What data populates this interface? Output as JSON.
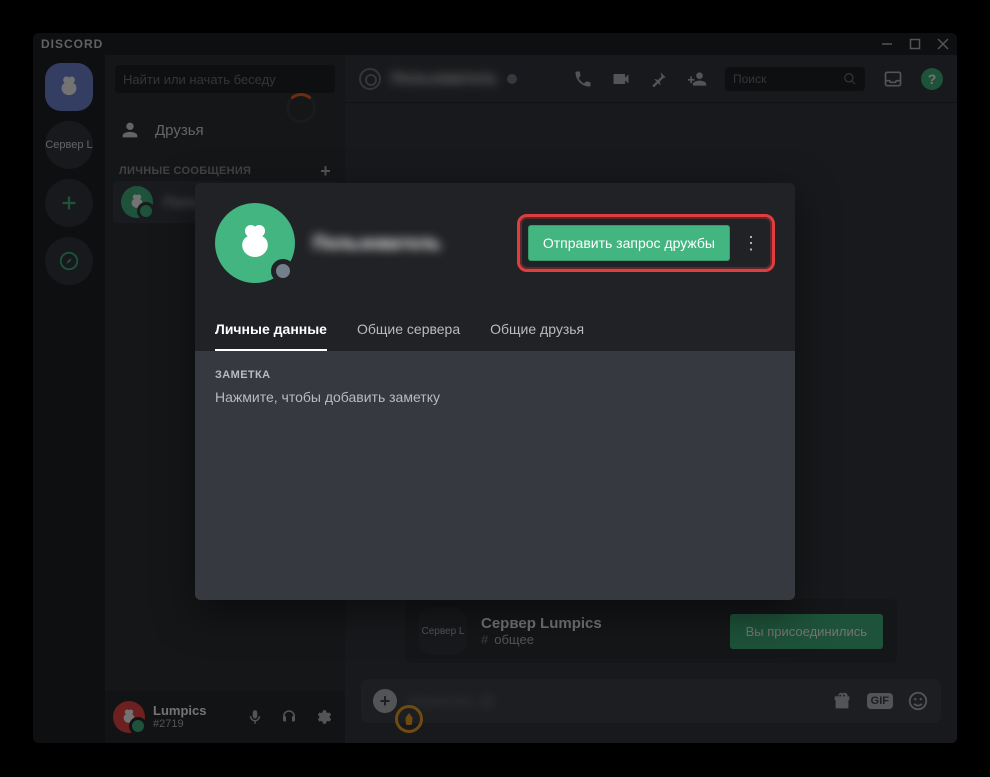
{
  "window": {
    "wordmark": "DISCORD"
  },
  "guilds": {
    "server_label": "Сервер L"
  },
  "sidebar": {
    "search_placeholder": "Найти или начать беседу",
    "friends_label": "Друзья",
    "dm_header": "ЛИЧНЫЕ СООБЩЕНИЯ",
    "dm_items": [
      {
        "name": "Пользователь"
      }
    ]
  },
  "user_panel": {
    "name": "Lumpics",
    "tag": "#2719"
  },
  "chat_header": {
    "name": "Пользователь",
    "search_placeholder": "Поиск"
  },
  "invite": {
    "logo_text": "Сервер L",
    "title": "Сервер Lumpics",
    "channel": "общее",
    "button": "Вы присоединились"
  },
  "chat_input": {
    "placeholder": "Написать @",
    "gif_label": "GIF"
  },
  "modal": {
    "username": "Пользователь",
    "friend_button": "Отправить запрос дружбы",
    "tabs": {
      "personal": "Личные данные",
      "servers": "Общие сервера",
      "friends": "Общие друзья"
    },
    "note_title": "ЗАМЕТКА",
    "note_placeholder": "Нажмите, чтобы добавить заметку"
  },
  "help_label": "?"
}
